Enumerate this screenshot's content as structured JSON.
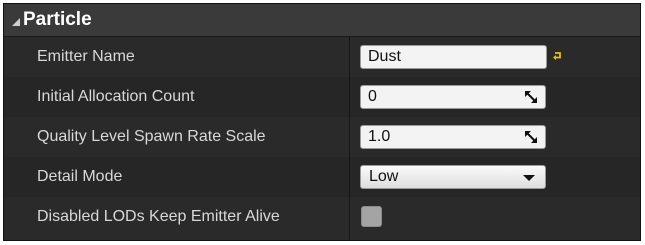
{
  "category": {
    "title": "Particle",
    "expanded": true
  },
  "rows": [
    {
      "label": "Emitter Name",
      "value": "Dust",
      "type": "text",
      "has_reset": true
    },
    {
      "label": "Initial Allocation Count",
      "value": "0",
      "type": "number"
    },
    {
      "label": "Quality Level Spawn Rate Scale",
      "value": "1.0",
      "type": "number"
    },
    {
      "label": "Detail Mode",
      "value": "Low",
      "type": "dropdown"
    },
    {
      "label": "Disabled LODs Keep Emitter Alive",
      "checked": false,
      "type": "checkbox"
    }
  ],
  "icons": {
    "collapse": "triangle-down-icon",
    "reset": "reset-to-default-icon",
    "drag": "drag-arrows-icon",
    "dropdown": "chevron-down-icon"
  },
  "colors": {
    "panel_bg": "#242424",
    "header_bg": "#3a3a3a",
    "label_text": "#d8d8d8",
    "reset_accent": "#e6c200"
  }
}
